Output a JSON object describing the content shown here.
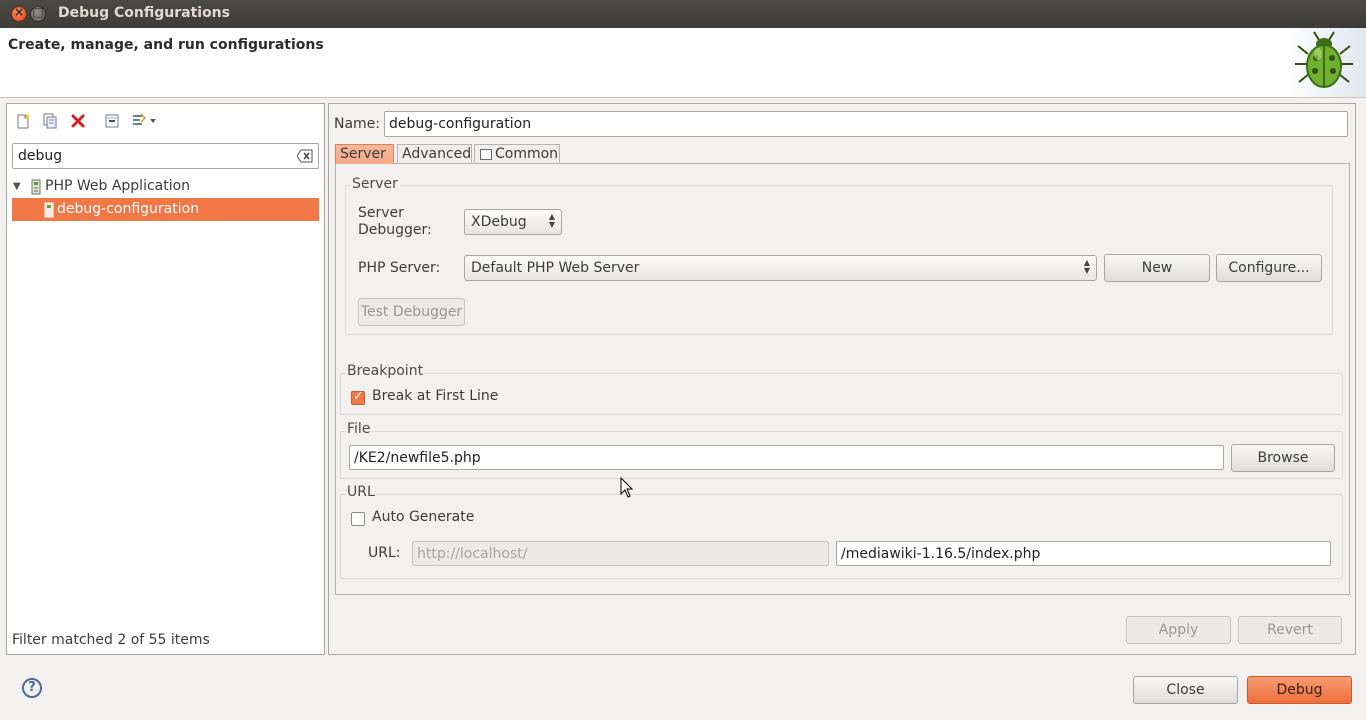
{
  "window": {
    "title": "Debug Configurations",
    "close_glyph": "×",
    "max_glyph": "□"
  },
  "banner": {
    "title": "Create, manage, and run configurations",
    "icon": "bug-icon"
  },
  "left": {
    "toolbar": [
      "new-configuration-icon",
      "duplicate-icon",
      "delete-icon",
      "collapse-all-icon",
      "filter-icon"
    ],
    "filter_value": "debug",
    "tree": {
      "parent": "PHP Web Application",
      "child": "debug-configuration"
    },
    "status": "Filter matched 2 of 55 items"
  },
  "right": {
    "name_label": "Name:",
    "name_value": "debug-configuration",
    "tabs": [
      "Server",
      "Advanced",
      "Common"
    ],
    "server_group": {
      "label": "Server",
      "debugger_label": "Server\nDebugger:",
      "debugger_value": "XDebug",
      "php_server_label": "PHP Server:",
      "php_server_value": "Default PHP Web Server",
      "new_button": "New",
      "configure_button": "Configure...",
      "test_button": "Test Debugger"
    },
    "breakpoint_group": {
      "label": "Breakpoint",
      "break_first_line": "Break at First Line",
      "break_first_line_checked": true
    },
    "file_group": {
      "label": "File",
      "path": "/KE2/newfile5.php",
      "browse_button": "Browse"
    },
    "url_group": {
      "label": "URL",
      "auto_generate": "Auto Generate",
      "auto_generate_checked": false,
      "url_label": "URL:",
      "base_url": "http://localhost/",
      "path_url": "/mediawiki-1.16.5/index.php"
    },
    "apply_button": "Apply",
    "revert_button": "Revert"
  },
  "footer": {
    "help_glyph": "?",
    "close_button": "Close",
    "debug_button": "Debug"
  },
  "colors": {
    "accent": "#f07746",
    "titlebar": "#3c3b37"
  }
}
